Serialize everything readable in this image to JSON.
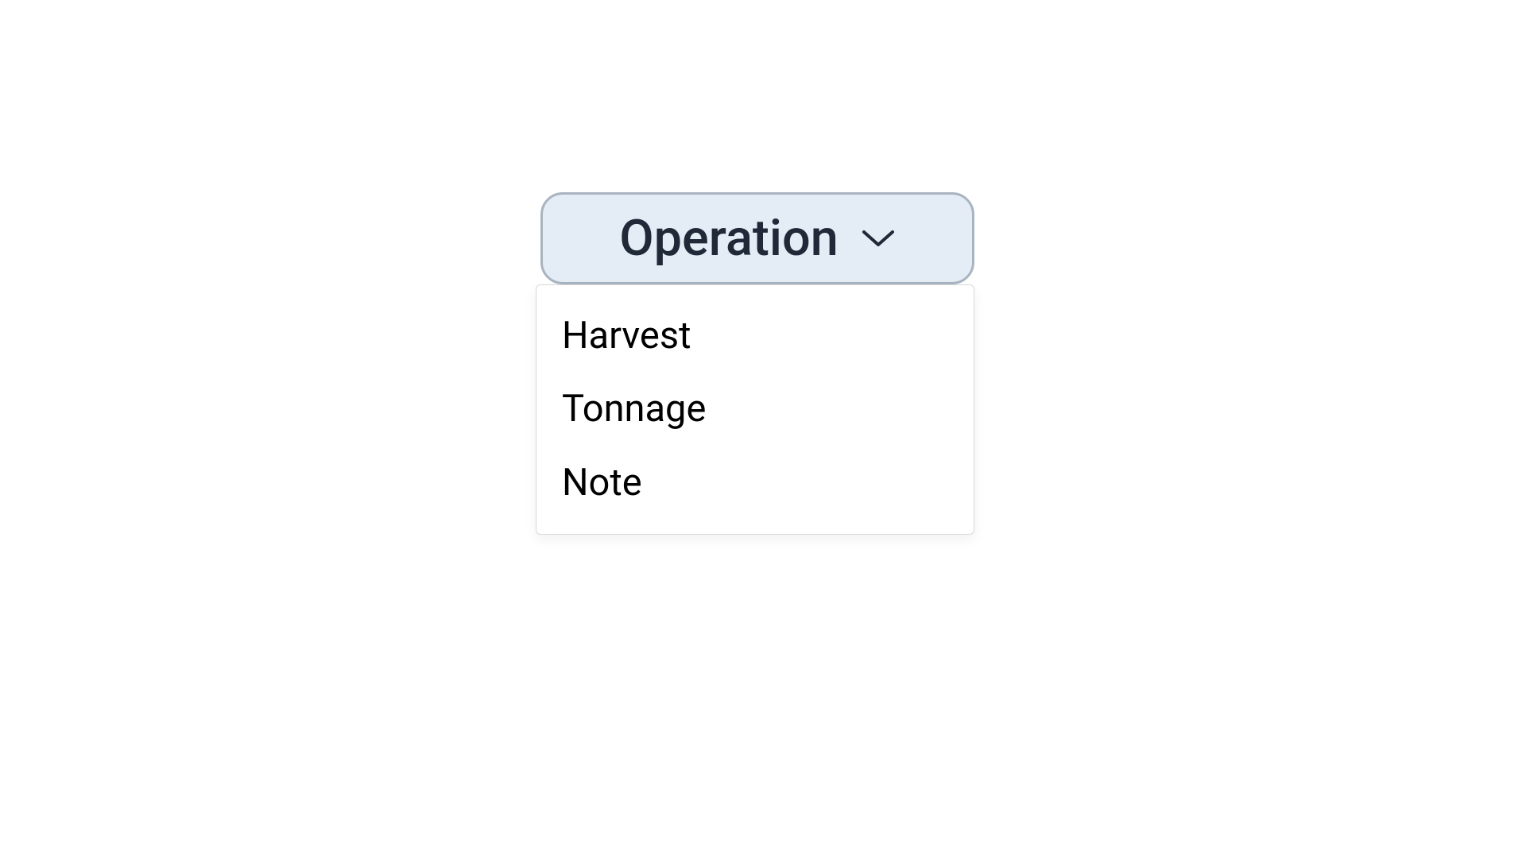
{
  "dropdown": {
    "label": "Operation",
    "options": [
      "Harvest",
      "Tonnage",
      "Note"
    ]
  }
}
